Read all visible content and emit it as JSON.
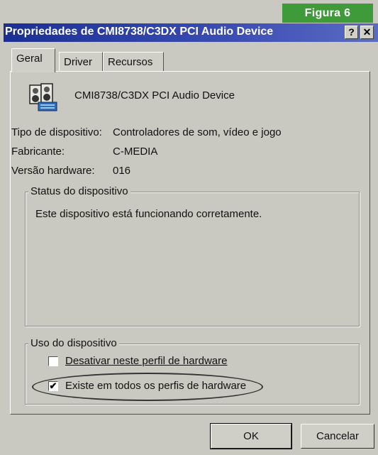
{
  "figure_label": "Figura 6",
  "window": {
    "title": "Propriedades de CMI8738/C3DX PCI Audio Device",
    "help_button": "?",
    "close_button": "✕"
  },
  "tabs": [
    {
      "label": "Geral",
      "active": true
    },
    {
      "label": "Driver",
      "active": false
    },
    {
      "label": "Recursos",
      "active": false
    }
  ],
  "device": {
    "name": "CMI8738/C3DX PCI Audio Device",
    "icon": "audio-device-icon",
    "type_label": "Tipo de dispositivo:",
    "type_value": "Controladores de som, vídeo e jogo",
    "manufacturer_label": "Fabricante:",
    "manufacturer_value": "C-MEDIA",
    "hw_version_label": "Versão hardware:",
    "hw_version_value": "016"
  },
  "status": {
    "group_label": "Status do dispositivo",
    "message": "Este dispositivo está funcionando corretamente."
  },
  "usage": {
    "group_label": "Uso do dispositivo",
    "options": [
      {
        "label": "Desativar neste perfil de hardware",
        "checked": false
      },
      {
        "label": "Existe em todos os perfis de hardware",
        "checked": true
      }
    ]
  },
  "buttons": {
    "ok": "OK",
    "cancel": "Cancelar"
  },
  "colors": {
    "title_bar": "#1a2f94",
    "figure_label_bg": "#3f9a3a",
    "dialog_bg": "#c9c9c2"
  }
}
